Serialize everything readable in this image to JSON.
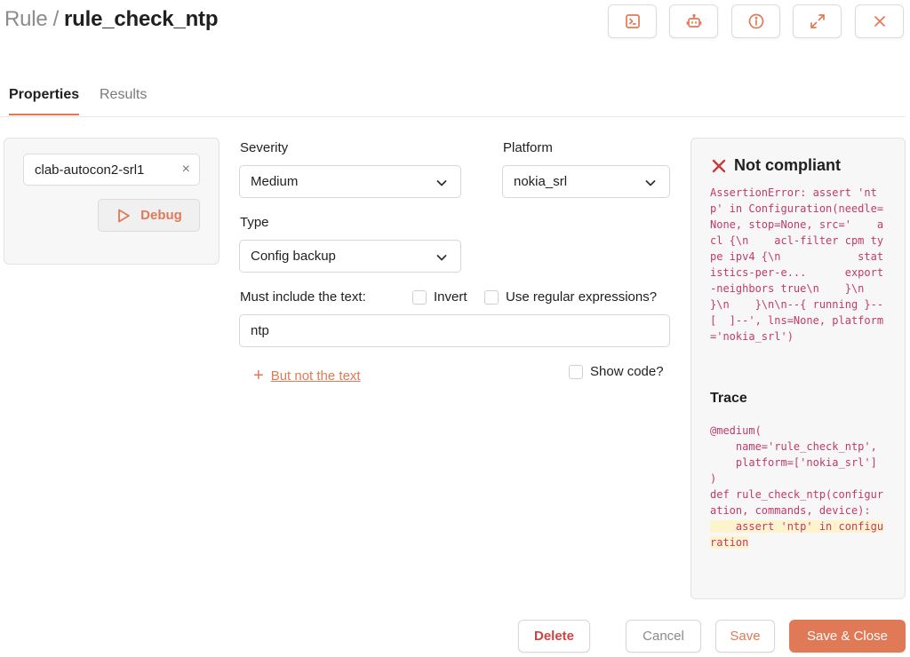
{
  "header": {
    "crumb": "Rule",
    "separator": "/",
    "title": "rule_check_ntp",
    "buttons": [
      {
        "icon": "terminal-icon"
      },
      {
        "icon": "robot-icon"
      },
      {
        "icon": "info-icon"
      },
      {
        "icon": "expand-icon"
      },
      {
        "icon": "close-icon"
      }
    ]
  },
  "tabs": {
    "properties": "Properties",
    "results": "Results",
    "active": "Properties"
  },
  "device_panel": {
    "device": "clab-autocon2-srl1",
    "remove_glyph": "×",
    "debug_label": "Debug"
  },
  "form": {
    "severity_label": "Severity",
    "severity_value": "Medium",
    "platform_label": "Platform",
    "platform_value": "nokia_srl",
    "type_label": "Type",
    "type_value": "Config backup",
    "must_include_label": "Must include the text:",
    "invert_label": "Invert",
    "invert_checked": false,
    "regex_label": "Use regular expressions?",
    "regex_checked": false,
    "text_value": "ntp",
    "but_not_label": "But not the text",
    "show_code_label": "Show code?",
    "show_code_checked": false
  },
  "result_panel": {
    "status": "Not compliant",
    "error": "AssertionError: assert 'ntp' in Configuration(needle=None, stop=None, src='    acl {\\n    acl-filter cpm type ipv4 {\\n            statistics-per-e...      export-neighbors true\\n    }\\n        }\\n    }\\n\\n--{ running }--[  ]--', lns=None, platform='nokia_srl')",
    "trace_heading": "Trace",
    "trace_code": "@medium(\n    name='rule_check_ntp',\n    platform=['nokia_srl']\n)\ndef rule_check_ntp(configuration, commands, device):",
    "trace_highlight": "    assert 'ntp' in configuration"
  },
  "footer": {
    "delete": "Delete",
    "cancel": "Cancel",
    "save": "Save",
    "save_close": "Save & Close"
  },
  "colors": {
    "accent": "#e07a56",
    "error": "#c63b3b",
    "code": "#c13a6c",
    "highlight": "#fdf3cc"
  }
}
